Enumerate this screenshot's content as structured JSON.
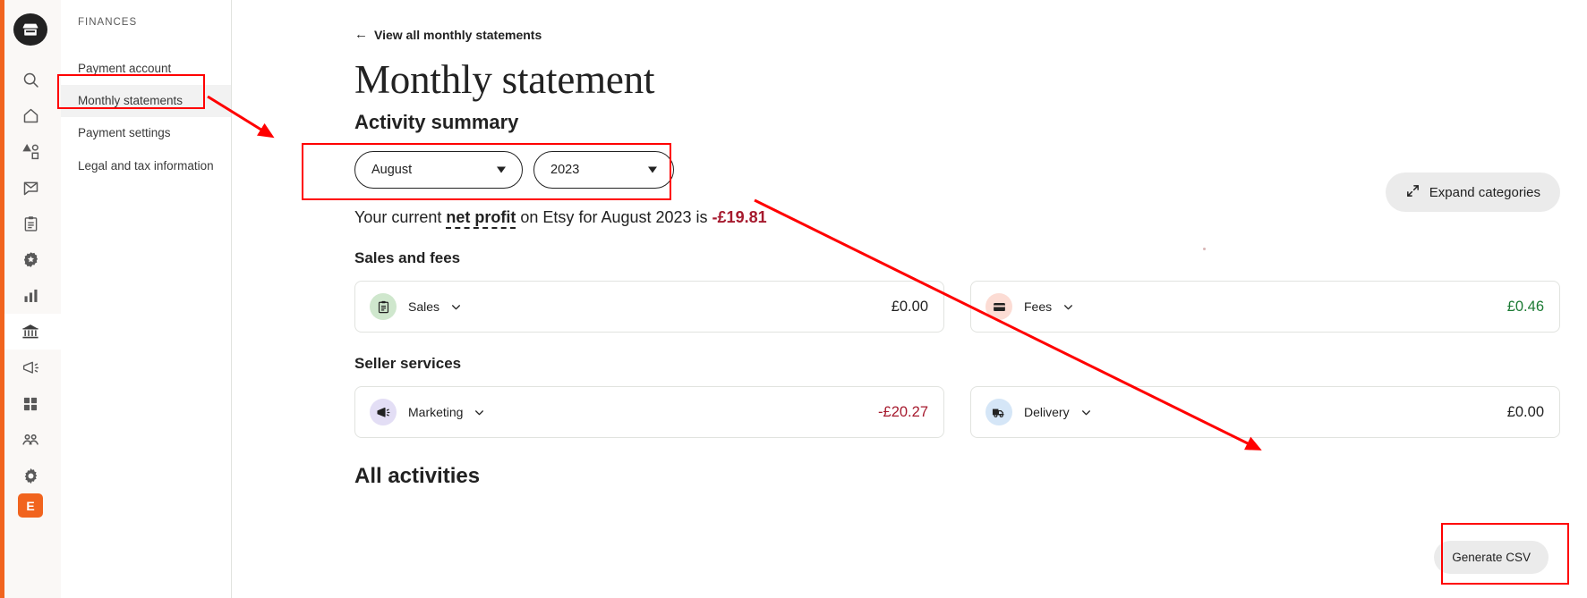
{
  "rail": {
    "logo_icon": "etsy-shop-icon",
    "avatar_initial": "E",
    "items": [
      {
        "icon": "search-icon",
        "name": "search"
      },
      {
        "icon": "home-icon",
        "name": "home"
      },
      {
        "icon": "listings-icon",
        "name": "listings"
      },
      {
        "icon": "messages-icon",
        "name": "messages"
      },
      {
        "icon": "orders-icon",
        "name": "orders"
      },
      {
        "icon": "star-badge-icon",
        "name": "star-seller"
      },
      {
        "icon": "stats-bar-icon",
        "name": "stats"
      },
      {
        "icon": "bank-icon",
        "name": "finances",
        "active": true
      },
      {
        "icon": "megaphone-icon",
        "name": "marketing"
      },
      {
        "icon": "grid-icon",
        "name": "integrations"
      },
      {
        "icon": "community-icon",
        "name": "community"
      },
      {
        "icon": "gear-icon",
        "name": "settings"
      }
    ]
  },
  "sidebar": {
    "heading": "FINANCES",
    "items": [
      {
        "label": "Payment account",
        "selected": false
      },
      {
        "label": "Monthly statements",
        "selected": true
      },
      {
        "label": "Payment settings",
        "selected": false
      },
      {
        "label": "Legal and tax information",
        "selected": false
      }
    ]
  },
  "main": {
    "back_link": "View all monthly statements",
    "back_icon": "arrow-left-icon",
    "page_title": "Monthly statement",
    "section_title": "Activity summary",
    "month_select": {
      "value": "August"
    },
    "year_select": {
      "value": "2023"
    },
    "expand_button": {
      "label": "Expand categories",
      "icon": "expand-arrows-icon"
    },
    "net_profit": {
      "prefix": "Your current ",
      "term": "net profit",
      "middle": " on Etsy for August 2023 is ",
      "value": "-£19.81"
    },
    "groups": [
      {
        "title": "Sales and fees",
        "cards": [
          {
            "label": "Sales",
            "icon": "clipboard-icon",
            "icon_color": "green",
            "amount": "£0.00",
            "amount_color": "dark"
          },
          {
            "label": "Fees",
            "icon": "credit-card-icon",
            "icon_color": "pink",
            "amount": "£0.46",
            "amount_color": "green"
          }
        ]
      },
      {
        "title": "Seller services",
        "cards": [
          {
            "label": "Marketing",
            "icon": "megaphone-icon",
            "icon_color": "purple",
            "amount": "-£20.27",
            "amount_color": "red"
          },
          {
            "label": "Delivery",
            "icon": "truck-icon",
            "icon_color": "blue",
            "amount": "£0.00",
            "amount_color": "dark"
          }
        ]
      }
    ],
    "all_activities_title": "All activities",
    "generate_csv_button": "Generate CSV"
  },
  "annotations": {
    "color": "#ff0000",
    "boxes": [
      {
        "name": "monthly-statements-highlight"
      },
      {
        "name": "date-filter-highlight"
      },
      {
        "name": "generate-csv-highlight"
      }
    ],
    "arrows": [
      {
        "name": "arrow-to-date-filter"
      },
      {
        "name": "arrow-to-generate-csv"
      }
    ]
  },
  "colors": {
    "brand_orange": "#f1641e",
    "positive_green": "#1b7a33",
    "negative_red": "#a61a2e",
    "annotation_red": "#ff0000"
  }
}
